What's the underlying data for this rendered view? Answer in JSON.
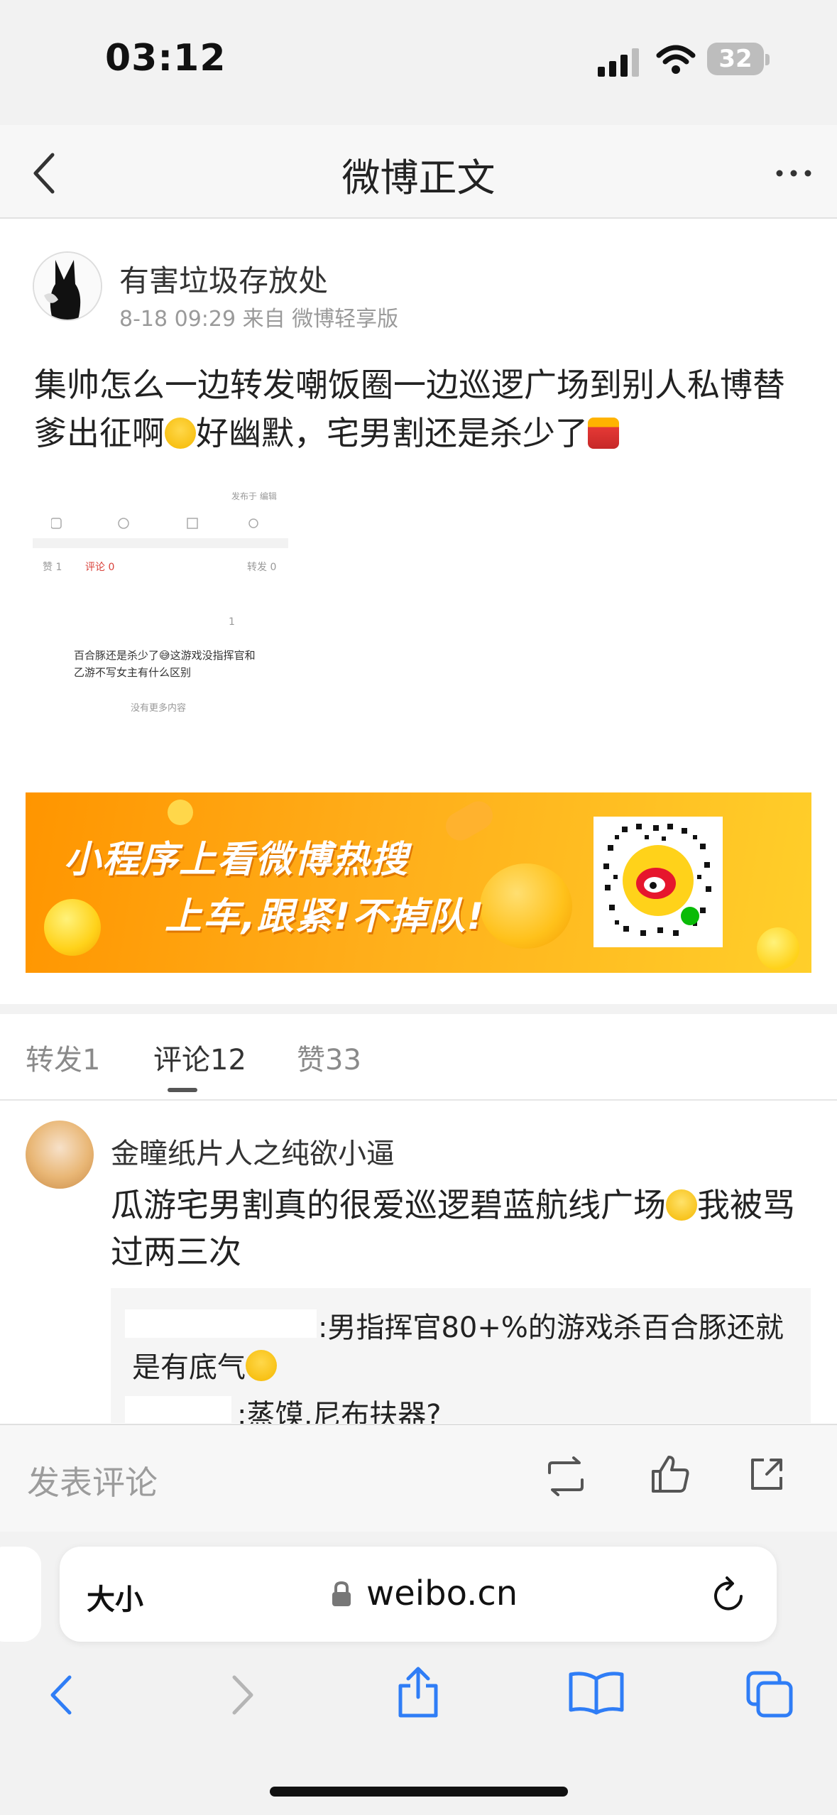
{
  "status_bar": {
    "time": "03:12",
    "battery": "32"
  },
  "nav": {
    "title": "微博正文"
  },
  "post": {
    "author": "有害垃圾存放处",
    "meta": "8-18 09:29 来自 微博轻享版",
    "text_part1": "集帅怎么一边转发嘲饭圈一边巡逻广场到别人私博替爹出征啊",
    "text_part2": "好幽默，宅男割还是杀少了",
    "embedded_image": {
      "top_right": "发布于 编辑",
      "likes": "赞 1",
      "comments": "评论 0",
      "reposts": "转发 0",
      "like_count": "1",
      "text_line1": "百合豚还是杀少了😅这游戏没指挥官和",
      "text_line2": "乙游不写女主有什么区别",
      "no_more": "没有更多内容"
    }
  },
  "banner": {
    "line1": "小程序上看微博热搜",
    "line2": "上车,跟紧!不掉队!"
  },
  "tabs": [
    {
      "label": "转发1"
    },
    {
      "label": "评论12"
    },
    {
      "label": "赞33"
    }
  ],
  "comment": {
    "user": "金瞳纸片人之纯欲小逼",
    "text_part1": "瓜游宅男割真的很爱巡逻碧蓝航线广场",
    "text_part2": "我被骂过两三次",
    "reply1": ":男指挥官80+%的游戏杀百合豚还就是有底气",
    "reply2": ":蒸馍,尼布扶器?"
  },
  "comment_bar": {
    "placeholder": "发表评论"
  },
  "safari": {
    "aa_label": "大小",
    "url": "weibo.cn"
  },
  "colors": {
    "banner": "#ffa31a",
    "link_blue": "#2f7df6",
    "tab_active": "#555555"
  }
}
